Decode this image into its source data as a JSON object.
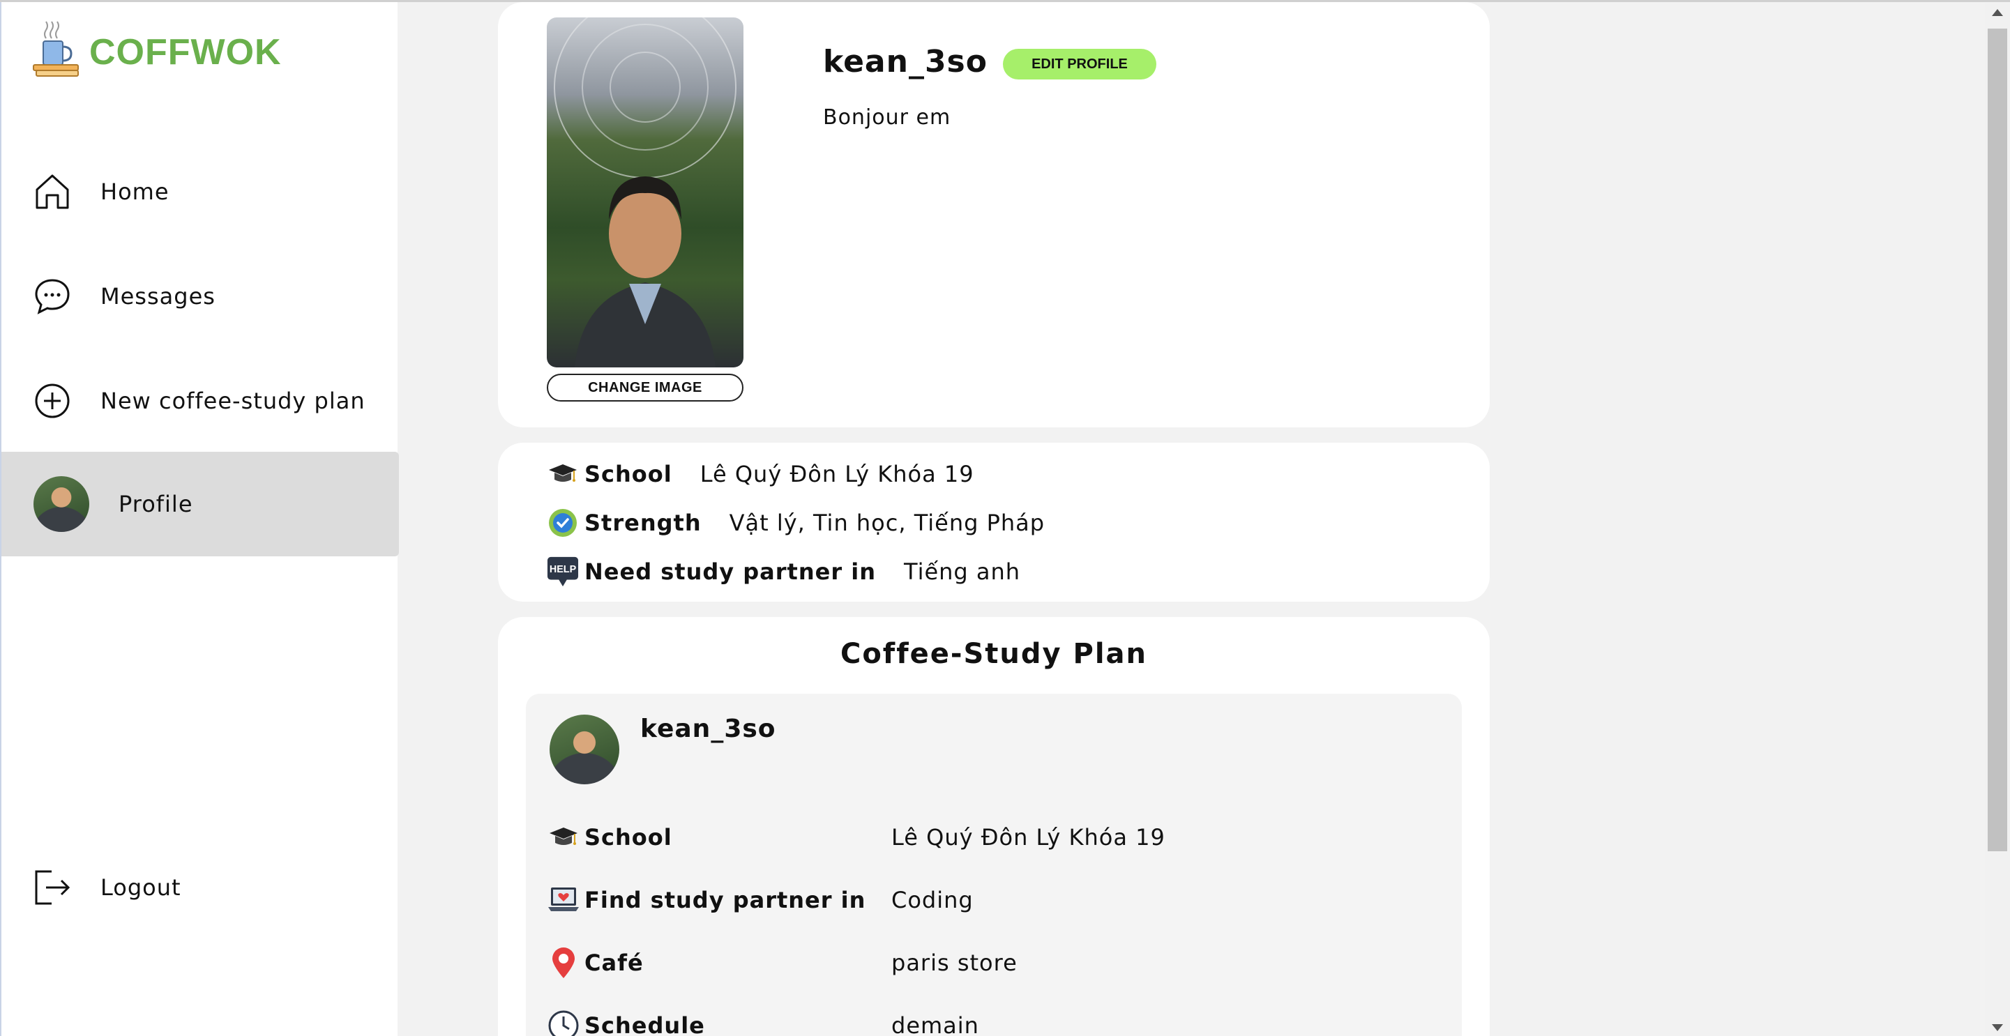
{
  "app": {
    "brand": "COFFWOK",
    "accent_color": "#6ab04c"
  },
  "sidebar": {
    "items": [
      {
        "label": "Home",
        "icon": "home-icon"
      },
      {
        "label": "Messages",
        "icon": "message-icon"
      },
      {
        "label": "New coffee-study plan",
        "icon": "plus-circle-icon"
      },
      {
        "label": "Profile",
        "icon": "avatar",
        "active": true
      }
    ],
    "logout": {
      "label": "Logout",
      "icon": "logout-icon"
    }
  },
  "profile": {
    "username": "kean_3so",
    "edit_label": "EDIT PROFILE",
    "edit_color": "#a6ef6a",
    "bio": "Bonjour em",
    "change_image_label": "CHANGE IMAGE"
  },
  "details": {
    "school": {
      "label": "School",
      "value": "Lê Quý Đôn Lý Khóa 19",
      "icon": "graduation-cap-icon"
    },
    "strength": {
      "label": "Strength",
      "value": "Vật lý, Tin học, Tiếng Pháp",
      "icon": "check-badge-icon"
    },
    "need": {
      "label": "Need study partner in",
      "value": "Tiếng anh",
      "icon": "help-icon"
    }
  },
  "plan": {
    "title": "Coffee-Study Plan",
    "username": "kean_3so",
    "rows": [
      {
        "label": "School",
        "value": "Lê Quý Đôn Lý Khóa 19",
        "icon": "graduation-cap-icon"
      },
      {
        "label": "Find study partner in",
        "value": "Coding",
        "icon": "laptop-icon"
      },
      {
        "label": "Café",
        "value": "paris store",
        "icon": "map-pin-icon"
      },
      {
        "label": "Schedule",
        "value": "demain",
        "icon": "clock-icon"
      }
    ]
  }
}
